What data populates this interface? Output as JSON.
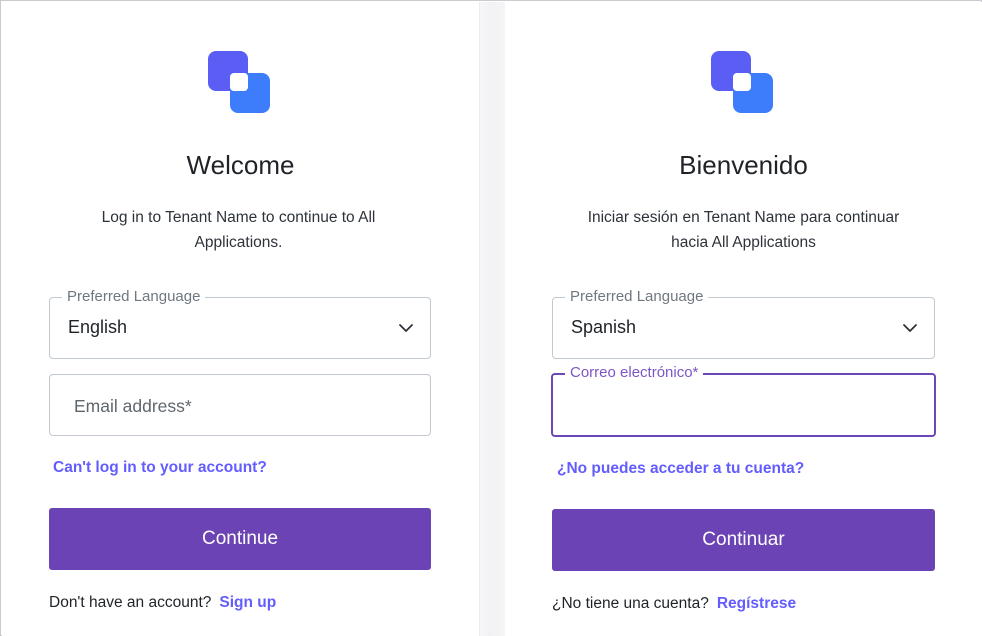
{
  "left": {
    "title": "Welcome",
    "subtitle_line1": "Log in to Tenant Name to continue to All",
    "subtitle_line2": "Applications.",
    "language_legend": "Preferred Language",
    "language_value": "English",
    "email_placeholder": "Email address*",
    "forgot_link": "Can't log in to your account?",
    "continue_label": "Continue",
    "signup_text": "Don't have an account?",
    "signup_link": "Sign up"
  },
  "right": {
    "title": "Bienvenido",
    "subtitle_line1": "Iniciar sesión en Tenant Name para continuar",
    "subtitle_line2": "hacia All Applications",
    "language_legend": "Preferred Language",
    "language_value": "Spanish",
    "email_legend": "Correo electrónico*",
    "email_value": "",
    "forgot_link": "¿No puedes acceder a tu cuenta?",
    "continue_label": "Continuar",
    "signup_text": "¿No tiene una cuenta?",
    "signup_link": "Regístrese"
  },
  "colors": {
    "primary_button": "#6b43b4",
    "link": "#635dff",
    "focus_border": "#6d46b8",
    "logo_primary": "#5b5ef5",
    "logo_secondary": "#3d7dfb"
  },
  "icons": {
    "logo": "brand-logo-icon",
    "dropdown": "chevron-down-icon"
  }
}
